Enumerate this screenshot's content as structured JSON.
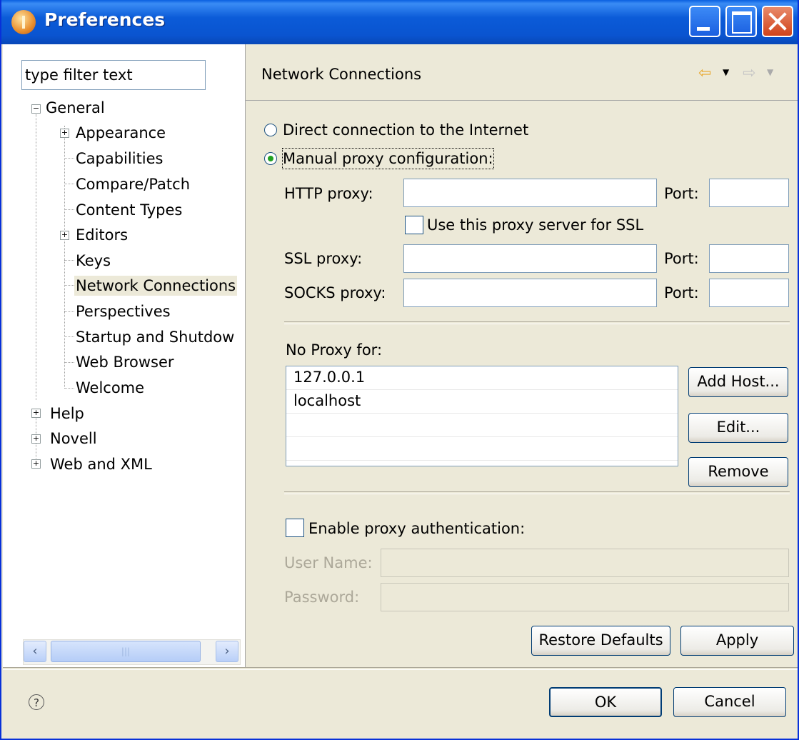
{
  "window": {
    "title": "Preferences"
  },
  "filter": {
    "placeholder": "type filter text"
  },
  "tree": {
    "general": "General",
    "appearance": "Appearance",
    "capabilities": "Capabilities",
    "compare_patch": "Compare/Patch",
    "content_types": "Content Types",
    "editors": "Editors",
    "keys": "Keys",
    "network_connections": "Network Connections",
    "perspectives": "Perspectives",
    "startup_shutdown": "Startup and Shutdow",
    "web_browser": "Web Browser",
    "welcome": "Welcome",
    "help": "Help",
    "novell": "Novell",
    "web_xml": "Web and XML"
  },
  "page": {
    "title": "Network Connections"
  },
  "proxy": {
    "direct_label": "Direct connection to the Internet",
    "manual_label": "Manual proxy configuration:",
    "selected": "manual",
    "http_label": "HTTP proxy:",
    "http_value": "",
    "http_port": "",
    "port_label": "Port:",
    "use_ssl_label": "Use this proxy server for SSL",
    "use_ssl_checked": false,
    "ssl_label": "SSL proxy:",
    "ssl_value": "",
    "ssl_port": "",
    "socks_label": "SOCKS proxy:",
    "socks_value": "",
    "socks_port": ""
  },
  "no_proxy": {
    "label": "No Proxy for:",
    "hosts": [
      "127.0.0.1",
      "localhost"
    ],
    "add_button": "Add Host...",
    "edit_button": "Edit...",
    "remove_button": "Remove"
  },
  "auth": {
    "enable_label": "Enable proxy authentication:",
    "enabled": false,
    "user_label": "User Name:",
    "user_value": "",
    "password_label": "Password:",
    "password_value": ""
  },
  "buttons": {
    "restore_defaults": "Restore Defaults",
    "apply": "Apply",
    "ok": "OK",
    "cancel": "Cancel"
  },
  "colors": {
    "titlebar": "#0a54d0",
    "dialog_bg": "#ece9d8",
    "radio_dot": "#21a121"
  }
}
